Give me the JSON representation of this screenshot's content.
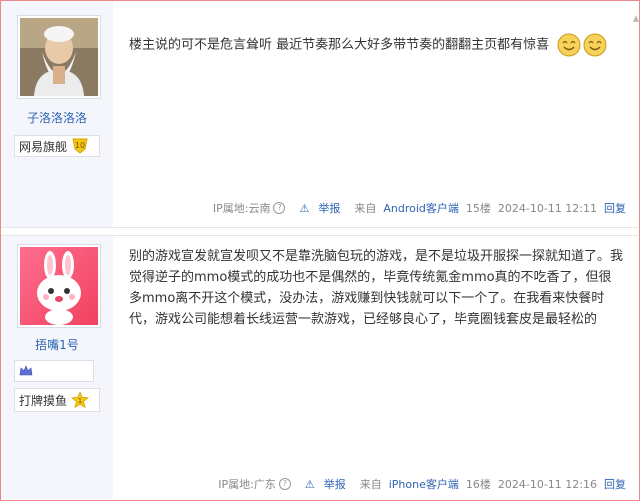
{
  "posts": [
    {
      "username": "子洛洛洛洛",
      "badge_label": "网易旗舰",
      "level": "10",
      "text": "楼主说的可不是危言耸听 最近节奏那么大好多带节奏的翻翻主页都有惊喜",
      "emojis": [
        "smiley-face-icon",
        "smiley-face-icon"
      ],
      "meta": {
        "ip": "IP属地:云南",
        "report": "举报",
        "from": "来自",
        "device": "Android客户端",
        "floor": "15楼",
        "time": "2024-10-11 12:11",
        "reply": "回复"
      }
    },
    {
      "username": "捂嘴1号",
      "badge_label": "打牌摸鱼",
      "level": "1",
      "text": "别的游戏宣发就宣发呗又不是靠洗脑包玩的游戏，是不是垃圾开服探一探就知道了。我觉得逆子的mmo模式的成功也不是偶然的，毕竟传统氪金mmo真的不吃香了，但很多mmo离不开这个模式，没办法，游戏赚到快钱就可以下一个了。在我看来快餐时代，游戏公司能想着长线运营一款游戏，已经够良心了，毕竟圈钱套皮是最轻松的",
      "meta": {
        "ip": "IP属地:广东",
        "report": "举报",
        "from": "来自",
        "device": "iPhone客户端",
        "floor": "16楼",
        "time": "2024-10-11 12:16",
        "reply": "回复"
      }
    }
  ],
  "colors": {
    "link": "#2d64b3",
    "sidebar_bg": "#f4f6fb",
    "frame_border": "#e88a8a"
  }
}
